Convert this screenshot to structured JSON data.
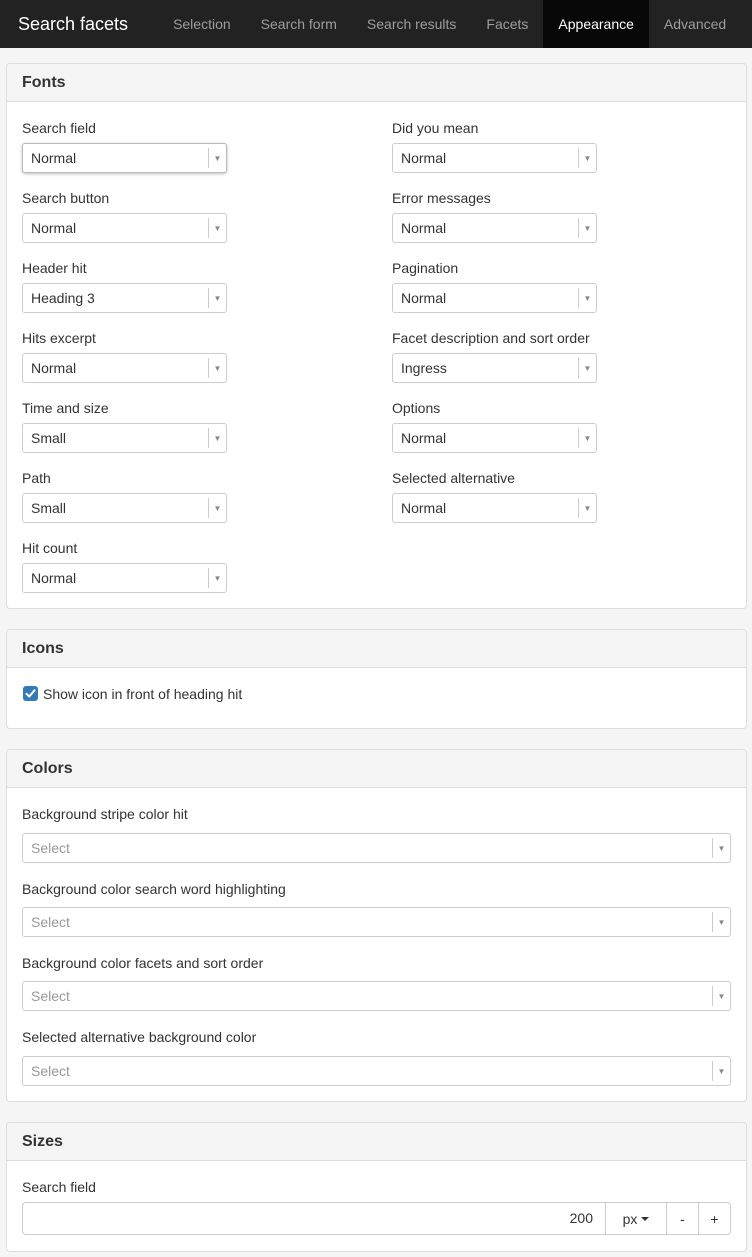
{
  "navbar": {
    "brand": "Search facets",
    "tabs": [
      {
        "label": "Selection",
        "active": false
      },
      {
        "label": "Search form",
        "active": false
      },
      {
        "label": "Search results",
        "active": false
      },
      {
        "label": "Facets",
        "active": false
      },
      {
        "label": "Appearance",
        "active": true
      },
      {
        "label": "Advanced",
        "active": false
      }
    ]
  },
  "fonts": {
    "title": "Fonts",
    "left": [
      {
        "label": "Search field",
        "value": "Normal"
      },
      {
        "label": "Search button",
        "value": "Normal"
      },
      {
        "label": "Header hit",
        "value": "Heading 3"
      },
      {
        "label": "Hits excerpt",
        "value": "Normal"
      },
      {
        "label": "Time and size",
        "value": "Small"
      },
      {
        "label": "Path",
        "value": "Small"
      },
      {
        "label": "Hit count",
        "value": "Normal"
      }
    ],
    "right": [
      {
        "label": "Did you mean",
        "value": "Normal"
      },
      {
        "label": "Error messages",
        "value": "Normal"
      },
      {
        "label": "Pagination",
        "value": "Normal"
      },
      {
        "label": "Facet description and sort order",
        "value": "Ingress"
      },
      {
        "label": "Options",
        "value": "Normal"
      },
      {
        "label": "Selected alternative",
        "value": "Normal"
      }
    ]
  },
  "icons": {
    "title": "Icons",
    "checkbox_label": "Show icon in front of heading hit",
    "checked": true,
    "checkbox_color": "#337ab7"
  },
  "colors": {
    "title": "Colors",
    "fields": [
      {
        "label": "Background stripe color hit",
        "placeholder": "Select"
      },
      {
        "label": "Background color search word highlighting",
        "placeholder": "Select"
      },
      {
        "label": "Background color facets and sort order",
        "placeholder": "Select"
      },
      {
        "label": "Selected alternative background color",
        "placeholder": "Select"
      }
    ]
  },
  "sizes": {
    "title": "Sizes",
    "search_field_label": "Search field",
    "search_field_value": "200",
    "unit": "px",
    "minus": "-",
    "plus": "+"
  }
}
